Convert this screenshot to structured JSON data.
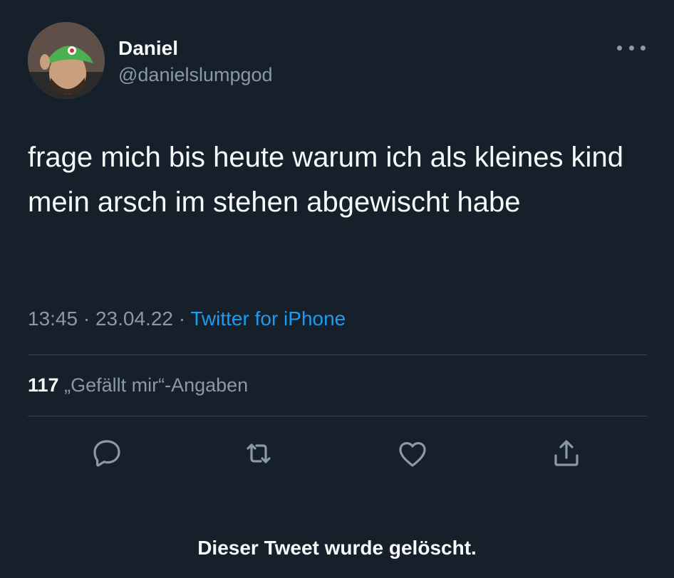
{
  "author": {
    "display_name": "Daniel",
    "handle": "@danielslumpgod"
  },
  "tweet": {
    "text": "frage mich bis heute warum ich als kleines kind mein arsch im stehen abgewischt habe",
    "time": "13:45",
    "date": "23.04.22",
    "separator": "·",
    "source": "Twitter for iPhone"
  },
  "stats": {
    "likes_count": "117",
    "likes_label": "„Gefällt mir“-Angaben"
  },
  "actions": {
    "reply_icon": "reply-icon",
    "retweet_icon": "retweet-icon",
    "like_icon": "heart-icon",
    "share_icon": "share-icon"
  },
  "notice": "Dieser Tweet wurde gelöscht.",
  "colors": {
    "background": "#15202b",
    "accent": "#1d9bf0",
    "secondary_text": "#8b98a5"
  }
}
